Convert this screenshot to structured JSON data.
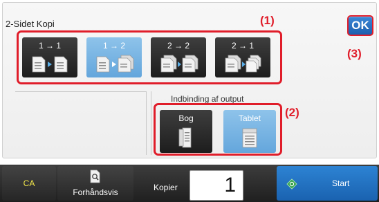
{
  "screen": {
    "title": "2-Sidet Kopi",
    "ok_label": "OK"
  },
  "callouts": [
    "(1)",
    "(2)",
    "(3)"
  ],
  "copy_modes": [
    {
      "label": "1 → 1",
      "selected": false
    },
    {
      "label": "1 → 2",
      "selected": true
    },
    {
      "label": "2 → 2",
      "selected": false
    },
    {
      "label": "2 → 1",
      "selected": false
    }
  ],
  "binding": {
    "label": "Indbinding af output",
    "options": [
      {
        "label": "Bog",
        "selected": false
      },
      {
        "label": "Tablet",
        "selected": true
      }
    ]
  },
  "bottom_bar": {
    "ca_label": "CA",
    "preview_label": "Forhåndsvis",
    "copies_label": "Kopier",
    "copies_value": "1",
    "start_label": "Start"
  },
  "colors": {
    "callout": "#e01d2a",
    "selected": "#79b6e3",
    "ok": "#2a73c6",
    "start": "#1f6dbf",
    "ca_text": "#f0e54a"
  },
  "icons": {
    "ok": "ok-icon",
    "preview": "magnifier-page-icon",
    "start": "start-diamond-icon",
    "book": "book-binding-icon",
    "tablet": "tablet-binding-icon"
  }
}
